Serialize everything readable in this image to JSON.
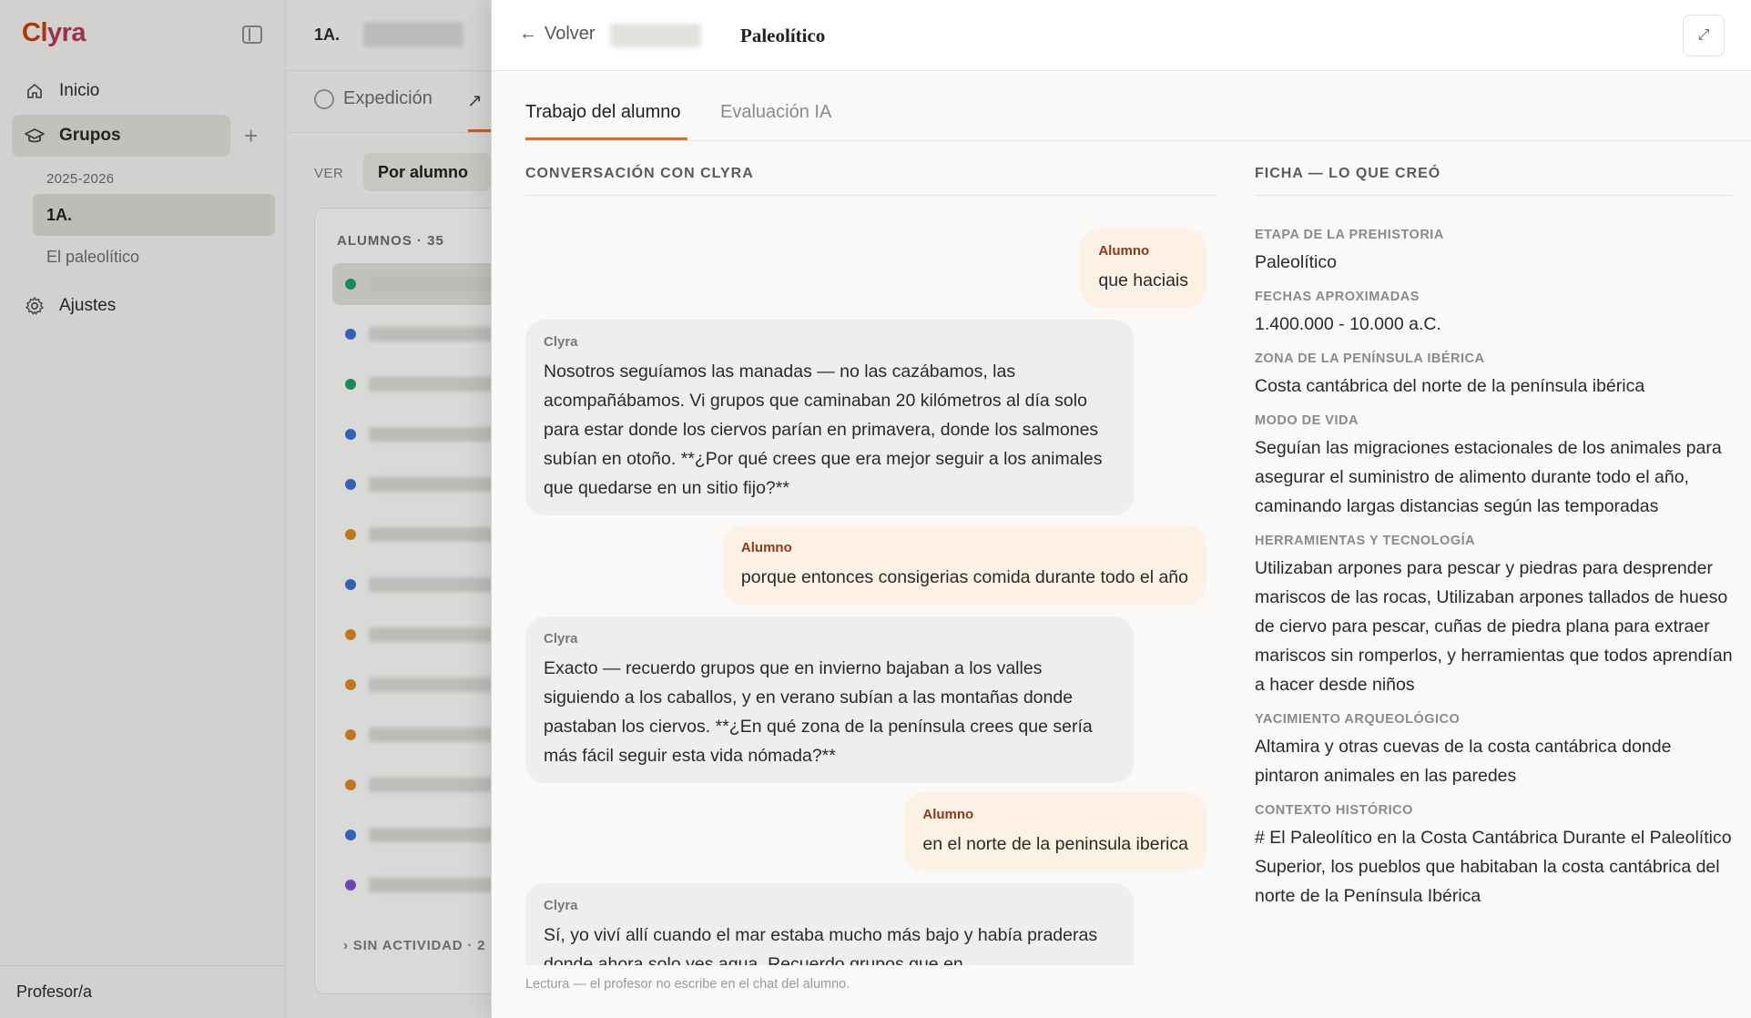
{
  "app": {
    "logo_part1": "Cl",
    "logo_part2": "yra"
  },
  "sidebar": {
    "nav": [
      {
        "label": "Inicio",
        "icon": "home-icon"
      },
      {
        "label": "Grupos",
        "icon": "graduation-cap-icon"
      },
      {
        "label": "Ajustes",
        "icon": "gear-icon"
      }
    ],
    "year": "2025-2026",
    "groups": [
      {
        "label": "1A."
      },
      {
        "label": "El paleolítico"
      }
    ],
    "footer": "Profesor/a"
  },
  "middle": {
    "title": "1A.",
    "tab_expedicion": "Expedición",
    "ver_label": "VER",
    "ver_value": "Por alumno",
    "alumnos_label": "ALUMNOS · 35",
    "sin_actividad": "› SIN ACTIVIDAD · 2",
    "student_dot_colors": [
      "#1e9e6a",
      "#3b6fd1",
      "#1e9e6a",
      "#3b6fd1",
      "#3b6fd1",
      "#d9891f",
      "#3b6fd1",
      "#d9891f",
      "#d9891f",
      "#d9891f",
      "#d9891f",
      "#3b6fd1",
      "#7b4fd1"
    ]
  },
  "drawer": {
    "back_label": "Volver",
    "title": "Paleolítico",
    "tabs": [
      "Trabajo del alumno",
      "Evaluación IA"
    ],
    "chat_label": "CONVERSACIÓN CON CLYRA",
    "ficha_label": "FICHA — LO QUE CREÓ",
    "messages": [
      {
        "who": "Alumno",
        "text": "que haciais"
      },
      {
        "who": "Clyra",
        "text": "Nosotros seguíamos las manadas — no las cazábamos, las acompañábamos. Vi grupos que caminaban 20 kilómetros al día solo para estar donde los ciervos parían en primavera, donde los salmones subían en otoño. **¿Por qué crees que era mejor seguir a los animales que quedarse en un sitio fijo?**"
      },
      {
        "who": "Alumno",
        "text": "porque entonces consigerias comida durante todo el año"
      },
      {
        "who": "Clyra",
        "text": "Exacto — recuerdo grupos que en invierno bajaban a los valles siguiendo a los caballos, y en verano subían a las montañas donde pastaban los ciervos. **¿En qué zona de la península crees que sería más fácil seguir esta vida nómada?**"
      },
      {
        "who": "Alumno",
        "text": "en el norte de la peninsula iberica"
      },
      {
        "who": "Clyra",
        "text": "Sí, yo viví allí cuando el mar estaba mucho más bajo y había praderas donde ahora solo ves agua. Recuerdo grupos que en"
      }
    ],
    "chat_footer": "Lectura — el profesor no escribe en el chat del alumno.",
    "ficha": [
      {
        "k": "ETAPA DE LA PREHISTORIA",
        "v": "Paleolítico"
      },
      {
        "k": "FECHAS APROXIMADAS",
        "v": "1.400.000 - 10.000 a.C."
      },
      {
        "k": "ZONA DE LA PENÍNSULA IBÉRICA",
        "v": "Costa cantábrica del norte de la península ibérica"
      },
      {
        "k": "MODO DE VIDA",
        "v": "Seguían las migraciones estacionales de los animales para asegurar el suministro de alimento durante todo el año, caminando largas distancias según las temporadas"
      },
      {
        "k": "HERRAMIENTAS Y TECNOLOGÍA",
        "v": "Utilizaban arpones para pescar y piedras para desprender mariscos de las rocas, Utilizaban arpones tallados de hueso de ciervo para pescar, cuñas de piedra plana para extraer mariscos sin romperlos, y herramientas que todos aprendían a hacer desde niños"
      },
      {
        "k": "YACIMIENTO ARQUEOLÓGICO",
        "v": "Altamira y otras cuevas de la costa cantábrica donde pintaron animales en las paredes"
      },
      {
        "k": "CONTEXTO HISTÓRICO",
        "v": "# El Paleolítico en la Costa Cantábrica Durante el Paleolítico Superior, los pueblos que habitaban la costa cantábrica del norte de la Península Ibérica"
      }
    ]
  }
}
